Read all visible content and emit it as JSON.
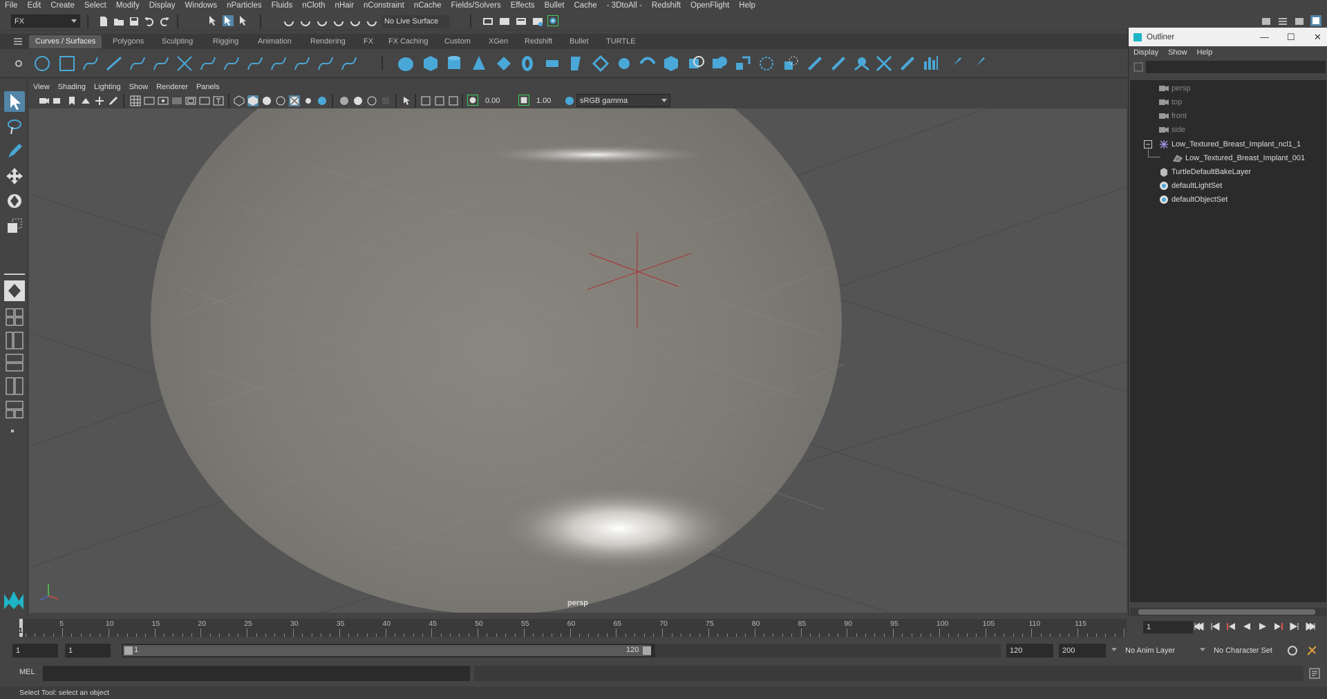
{
  "menubar": {
    "items": [
      "File",
      "Edit",
      "Create",
      "Select",
      "Modify",
      "Display",
      "Windows",
      "nParticles",
      "Fluids",
      "nCloth",
      "nHair",
      "nConstraint",
      "nCache",
      "Fields/Solvers",
      "Effects",
      "Bullet",
      "Cache",
      "- 3DtoAll -",
      "Redshift",
      "OpenFlight",
      "Help"
    ]
  },
  "statusline": {
    "menuset": "FX",
    "live_surface": "No Live Surface"
  },
  "shelf": {
    "tabs": [
      "Curves / Surfaces",
      "Polygons",
      "Sculpting",
      "Rigging",
      "Animation",
      "Rendering",
      "FX",
      "FX Caching",
      "Custom",
      "XGen",
      "Redshift",
      "Bullet",
      "TURTLE"
    ],
    "active_tab": "Curves / Surfaces"
  },
  "viewport": {
    "menu": [
      "View",
      "Shading",
      "Lighting",
      "Show",
      "Renderer",
      "Panels"
    ],
    "exposure": "0.00",
    "gamma": "1.00",
    "colorspace": "sRGB gamma",
    "camera_label": "persp"
  },
  "outliner": {
    "title": "Outliner",
    "menu": [
      "Display",
      "Show",
      "Help"
    ],
    "items": [
      {
        "label": "persp",
        "icon": "camera-icon",
        "dim": true
      },
      {
        "label": "top",
        "icon": "camera-icon",
        "dim": true
      },
      {
        "label": "front",
        "icon": "camera-icon",
        "dim": true
      },
      {
        "label": "side",
        "icon": "camera-icon",
        "dim": true
      },
      {
        "label": "Low_Textured_Breast_Implant_ncl1_1",
        "icon": "group-icon",
        "dim": false
      },
      {
        "label": "Low_Textured_Breast_Implant_001",
        "icon": "mesh-icon",
        "dim": false
      },
      {
        "label": "TurtleDefaultBakeLayer",
        "icon": "layer-icon",
        "dim": false
      },
      {
        "label": "defaultLightSet",
        "icon": "set-icon",
        "dim": false
      },
      {
        "label": "defaultObjectSet",
        "icon": "set-icon",
        "dim": false
      }
    ]
  },
  "timeline": {
    "ticks": [
      "5",
      "10",
      "15",
      "20",
      "25",
      "30",
      "35",
      "40",
      "45",
      "50",
      "55",
      "60",
      "65",
      "70",
      "75",
      "80",
      "85",
      "90",
      "95",
      "100",
      "105",
      "110",
      "115"
    ],
    "start_marker": "1",
    "current_frame": "1"
  },
  "range": {
    "start": "1",
    "playback_start": "1",
    "slider_start": "1",
    "slider_end": "120",
    "playback_end": "120",
    "end": "200",
    "anim_layer": "No Anim Layer",
    "character_set": "No Character Set"
  },
  "cmdline": {
    "label": "MEL"
  },
  "helpline": {
    "text": "Select Tool: select an object"
  },
  "colors": {
    "accent": "#5285a6",
    "shelf_icon": "#4aa8d8"
  }
}
